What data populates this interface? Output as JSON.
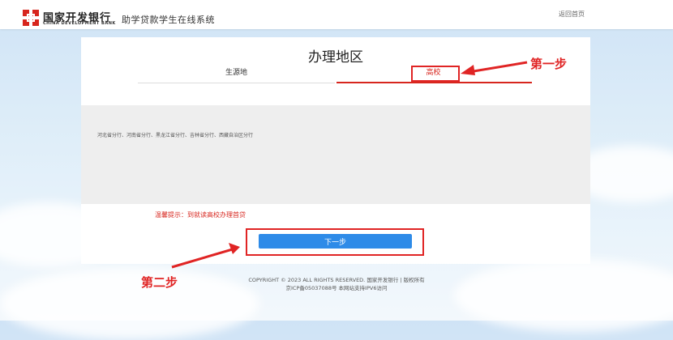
{
  "header": {
    "bank_name_cn": "国家开发银行",
    "bank_name_en": "CHINA DEVELOPMENT BANK",
    "system_title": "助学贷款学生在线系统",
    "back_home": "返回首页"
  },
  "main": {
    "title": "办理地区",
    "tabs": [
      {
        "label": "生源地",
        "active": false
      },
      {
        "label": "高校",
        "active": true
      }
    ],
    "regions_text": "河北省分行、河南省分行、黑龙江省分行、吉林省分行、西藏自治区分行",
    "hint": "温馨提示：到就读高校办理首贷",
    "next_button": "下一步"
  },
  "footer": {
    "line1": "COPYRIGHT © 2023 ALL RIGHTS RESERVED. 国家开发银行 | 版权所有",
    "line2": "京ICP备05037088号 本网站支持IPV6访问"
  },
  "annotations": {
    "step1": "第一步",
    "step2": "第二步"
  },
  "colors": {
    "brand_red": "#d7261e",
    "button_blue": "#2e8be8",
    "annotation_red": "#e02424"
  }
}
